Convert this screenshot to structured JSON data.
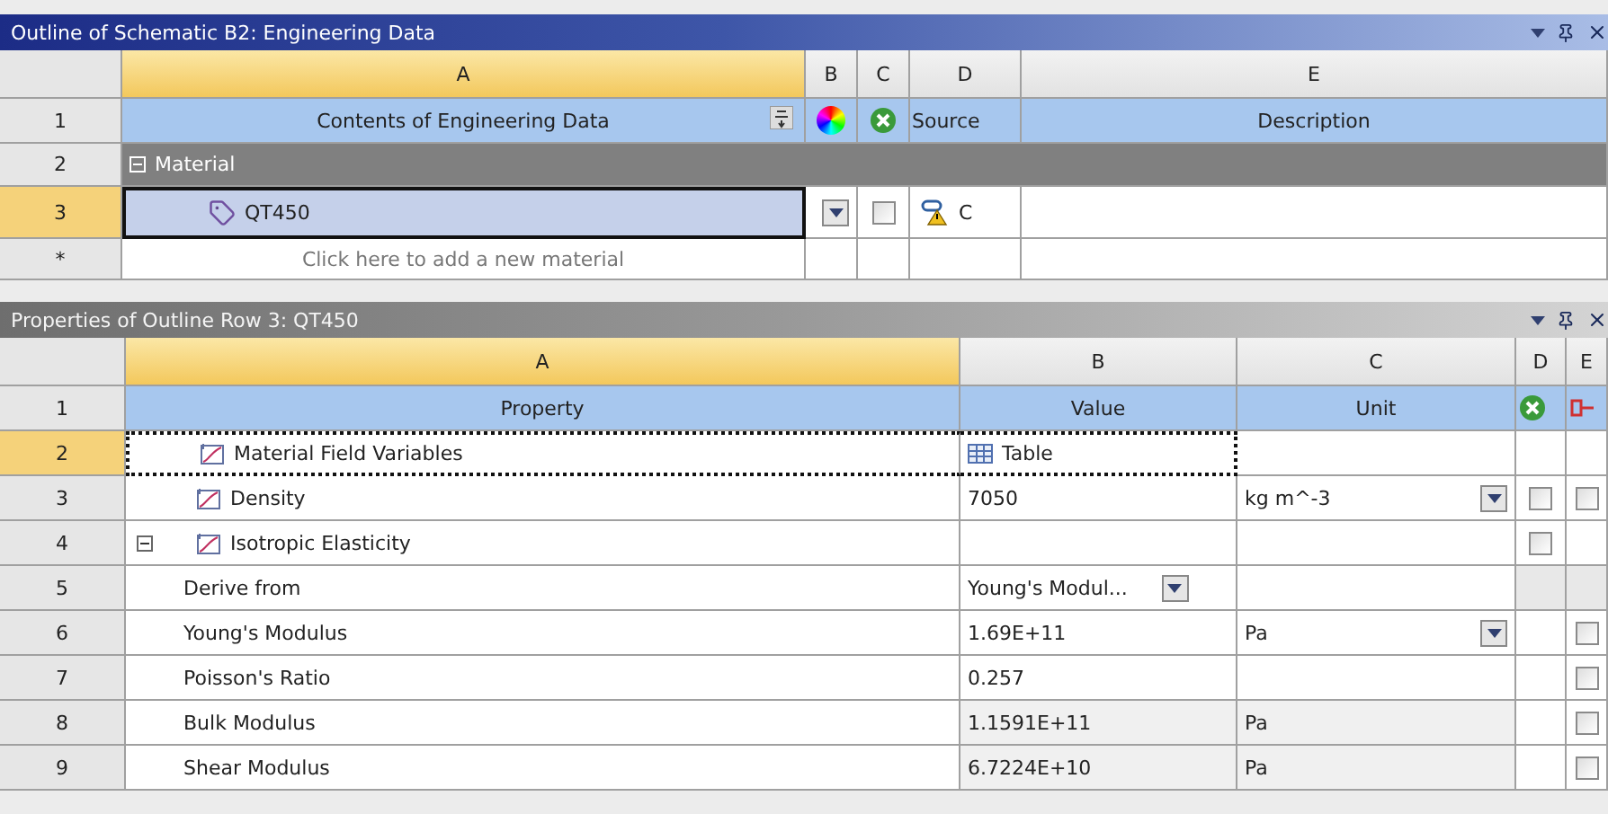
{
  "outline": {
    "title": "Outline of Schematic B2: Engineering Data",
    "columns": [
      {
        "label": "A",
        "selected": true
      },
      {
        "label": "B",
        "selected": false
      },
      {
        "label": "C",
        "selected": false
      },
      {
        "label": "D",
        "selected": false
      },
      {
        "label": "E",
        "selected": false
      }
    ],
    "header_row": {
      "number": "1",
      "contents": "Contents of Engineering Data",
      "source": "Source",
      "description": "Description"
    },
    "group": {
      "number": "2",
      "label": "Material",
      "expanded": true
    },
    "materials": [
      {
        "number": "3",
        "name": "QT450",
        "selected": true,
        "checked": false,
        "source": "C"
      }
    ],
    "new_row": {
      "number": "*",
      "placeholder": "Click here to add a new material"
    }
  },
  "properties": {
    "title": "Properties of Outline Row 3: QT450",
    "columns": [
      {
        "label": "A",
        "selected": true
      },
      {
        "label": "B",
        "selected": false
      },
      {
        "label": "C",
        "selected": false
      },
      {
        "label": "D",
        "selected": false
      },
      {
        "label": "E",
        "selected": false
      }
    ],
    "header_row": {
      "number": "1",
      "property": "Property",
      "value": "Value",
      "unit": "Unit"
    },
    "rows": [
      {
        "number": "2",
        "kind": "property",
        "name": "Material Field Variables",
        "value": "Table",
        "table_icon": true,
        "selected": true
      },
      {
        "number": "3",
        "kind": "property",
        "name": "Density",
        "value": "7050",
        "unit": "kg m^-3",
        "unit_dropdown": true,
        "d_checked": false,
        "e_checked": false,
        "selected": false
      },
      {
        "number": "4",
        "kind": "property",
        "name": "Isotropic Elasticity",
        "expanded": true,
        "d_checked": false,
        "selected": false,
        "children": [
          {
            "number": "5",
            "kind": "setting",
            "name": "Derive from",
            "value": "Young's Modul...",
            "value_dropdown": true,
            "selected": false,
            "flags_disabled": true
          },
          {
            "number": "6",
            "kind": "setting",
            "name": "Young's Modulus",
            "value": "1.69E+11",
            "unit": "Pa",
            "unit_dropdown": true,
            "e_checked": false,
            "selected": false
          },
          {
            "number": "7",
            "kind": "setting",
            "name": "Poisson's Ratio",
            "value": "0.257",
            "e_checked": false,
            "selected": false
          },
          {
            "number": "8",
            "kind": "setting",
            "name": "Bulk Modulus",
            "value": "1.1591E+11",
            "unit": "Pa",
            "read_only": true,
            "e_checked": false,
            "selected": false
          },
          {
            "number": "9",
            "kind": "setting",
            "name": "Shear Modulus",
            "value": "6.7224E+10",
            "unit": "Pa",
            "read_only": true,
            "e_checked": false,
            "selected": false
          }
        ]
      }
    ]
  }
}
